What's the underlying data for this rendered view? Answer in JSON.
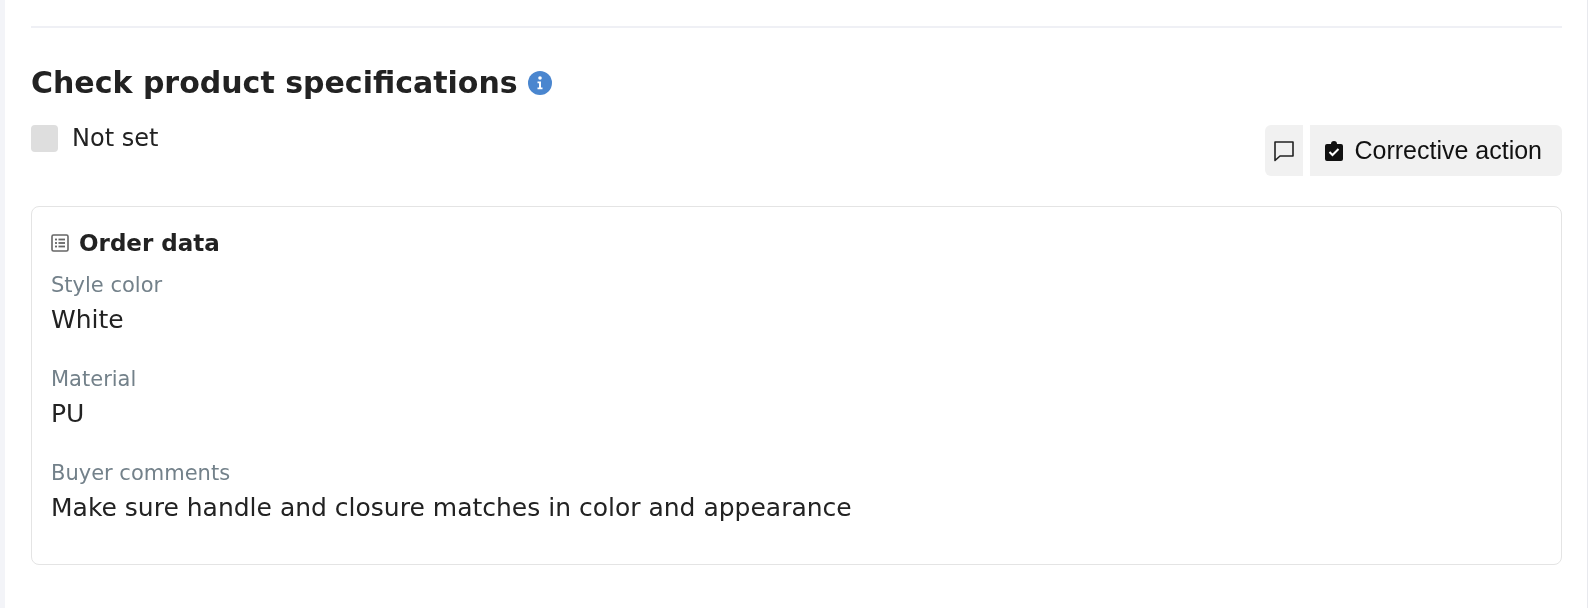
{
  "section": {
    "title": "Check product specifications"
  },
  "status": {
    "label": "Not set",
    "checked": false
  },
  "actions": [
    {
      "kind": "comment"
    },
    {
      "kind": "corrective",
      "label": "Corrective action"
    }
  ],
  "order_data": {
    "title": "Order data",
    "fields": [
      {
        "label": "Style color",
        "value": "White"
      },
      {
        "label": "Material",
        "value": "PU"
      },
      {
        "label": "Buyer comments",
        "value": "Make sure handle and closure matches in color and appearance"
      }
    ]
  }
}
